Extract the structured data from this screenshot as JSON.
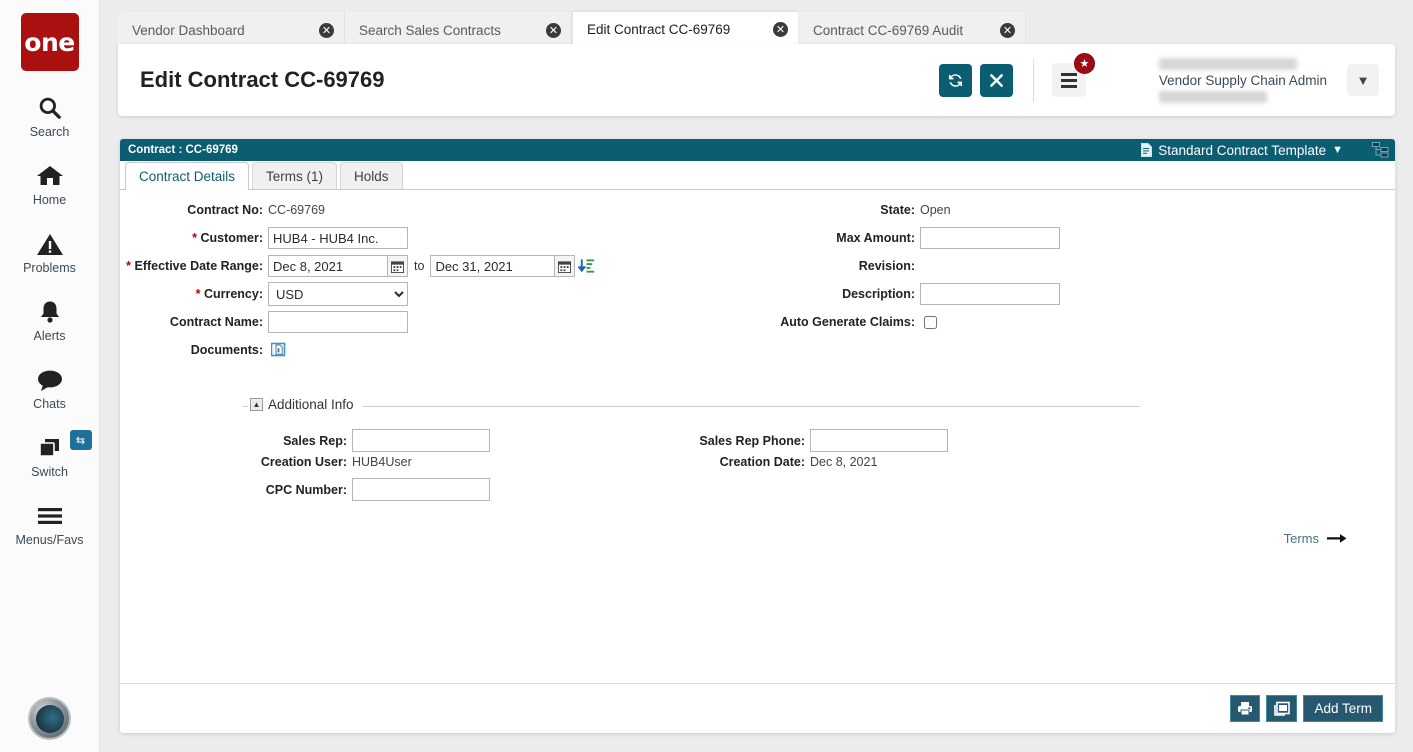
{
  "rail": {
    "logo_text": "one",
    "items": [
      {
        "label": "Search",
        "icon": "search-icon"
      },
      {
        "label": "Home",
        "icon": "home-icon"
      },
      {
        "label": "Problems",
        "icon": "warning-triangle-icon"
      },
      {
        "label": "Alerts",
        "icon": "bell-icon"
      },
      {
        "label": "Chats",
        "icon": "chat-bubble-icon"
      },
      {
        "label": "Switch",
        "icon": "windows-stack-icon",
        "badge_icon": "swap-arrows-icon"
      },
      {
        "label": "Menus/Favs",
        "icon": "hamburger-icon"
      }
    ],
    "avatar_icon": "user-avatar-icon"
  },
  "browser_tabs": [
    {
      "label": "Vendor Dashboard",
      "active": false
    },
    {
      "label": "Search Sales Contracts",
      "active": false
    },
    {
      "label": "Edit Contract CC-69769",
      "active": true
    },
    {
      "label": "Contract CC-69769 Audit",
      "active": false
    }
  ],
  "header": {
    "title": "Edit Contract CC-69769",
    "refresh_icon": "refresh-icon",
    "close_icon": "close-x-icon",
    "menu_icon": "hamburger-menu-icon",
    "badge_icon": "star-badge-icon",
    "user_name": "Vendor Supply Chain Admin",
    "caret_icon": "chevron-down-icon",
    "accent_color": "#0b5e72"
  },
  "contract_bar": {
    "title": "Contract : CC-69769",
    "template_label": "Standard Contract Template",
    "template_icon": "document-icon",
    "template_caret_icon": "caret-down-icon",
    "hierarchy_icon": "org-tree-icon"
  },
  "sub_tabs": [
    {
      "label": "Contract Details",
      "active": true
    },
    {
      "label": "Terms (1)",
      "active": false
    },
    {
      "label": "Holds",
      "active": false
    }
  ],
  "form": {
    "left": {
      "contract_no_label": "Contract No:",
      "contract_no_value": "CC-69769",
      "customer_label": "Customer:",
      "customer_value": "HUB4 - HUB4 Inc.",
      "effective_label": "Effective Date Range:",
      "effective_from": "Dec 8, 2021",
      "effective_to_word": "to",
      "effective_to": "Dec 31, 2021",
      "calendar_icon": "calendar-icon",
      "sort_icon": "sort-descending-icon",
      "currency_label": "Currency:",
      "currency_value": "USD",
      "currency_options": [
        "USD"
      ],
      "contract_name_label": "Contract Name:",
      "contract_name_value": "",
      "documents_label": "Documents:",
      "documents_icon": "attach-document-icon"
    },
    "right": {
      "state_label": "State:",
      "state_value": "Open",
      "max_amount_label": "Max Amount:",
      "max_amount_value": "",
      "revision_label": "Revision:",
      "revision_value": "",
      "description_label": "Description:",
      "description_value": "",
      "auto_claims_label": "Auto Generate Claims:",
      "auto_claims_checked": false
    },
    "additional_info": {
      "legend": "Additional Info",
      "collapse_icon": "caret-up-icon",
      "sales_rep_label": "Sales Rep:",
      "sales_rep_value": "",
      "sales_rep_phone_label": "Sales Rep Phone:",
      "sales_rep_phone_value": "",
      "creation_user_label": "Creation User:",
      "creation_user_value": "HUB4User",
      "creation_date_label": "Creation Date:",
      "creation_date_value": "Dec 8, 2021",
      "cpc_number_label": "CPC Number:",
      "cpc_number_value": ""
    },
    "terms_link_label": "Terms",
    "terms_arrow_icon": "arrow-right-icon"
  },
  "footer": {
    "print_icon": "printer-icon",
    "export_icon": "export-window-icon",
    "add_term_label": "Add Term"
  }
}
